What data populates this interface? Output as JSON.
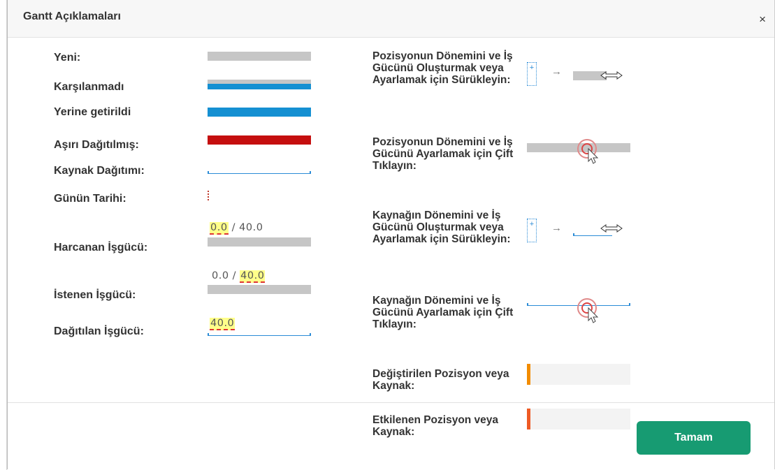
{
  "dialog": {
    "title": "Gantt Açıklamaları",
    "close_symbol": "×",
    "ok_label": "Tamam"
  },
  "legend_left": [
    {
      "label": "Yeni:",
      "color": "#c6c6c6"
    },
    {
      "label": "Karşılanmadı",
      "color": "#1590d2"
    },
    {
      "label": "Yerine getirildi",
      "color": "#1590d2"
    },
    {
      "label": "Aşırı Dağıtılmış:",
      "color": "#c50f0f"
    },
    {
      "label": "Kaynak Dağıtımı:",
      "color": "#2a8bd6"
    },
    {
      "label": "Günün Tarihi:",
      "color": "#c0392b"
    },
    {
      "label": "Harcanan İşgücü:",
      "value_a": "0.0",
      "separator": " / ",
      "value_b": "40.0"
    },
    {
      "label": "İstenen İşgücü:",
      "value_a": "0.0",
      "separator": " / ",
      "value_b": "40.0"
    },
    {
      "label": "Dağıtılan İşgücü:",
      "value_a": "40.0"
    }
  ],
  "legend_right": [
    {
      "label": "Pozisyonun Dönemini ve İş Gücünü Oluşturmak veya Ayarlamak için Sürükleyin:",
      "plus": "+",
      "arrow": "→"
    },
    {
      "label": "Pozisyonun Dönemini ve İş Gücünü Ayarlamak için Çift Tıklayın:"
    },
    {
      "label": "Kaynağın Dönemini ve İş Gücünü Oluşturmak veya Ayarlamak için Sürükleyin:",
      "plus": "+",
      "arrow": "→"
    },
    {
      "label": "Kaynağın Dönemini ve İş Gücünü Ayarlamak için Çift Tıklayın:"
    },
    {
      "label": "Değiştirilen Pozisyon veya Kaynak:",
      "color": "#f28c00"
    },
    {
      "label": "Etkilenen Pozisyon veya Kaynak:",
      "color": "#ee5a24"
    }
  ],
  "colors": {
    "accent_button": "#179b72",
    "grey_bar": "#c6c6c6",
    "blue_bar": "#1590d2",
    "red_bar": "#c50f0f",
    "highlight": "#ffff8a"
  },
  "icons": [
    "close-icon",
    "plus-icon",
    "arrow-right-icon",
    "resize-cursor-icon",
    "double-click-target-icon",
    "pointer-cursor-icon"
  ]
}
